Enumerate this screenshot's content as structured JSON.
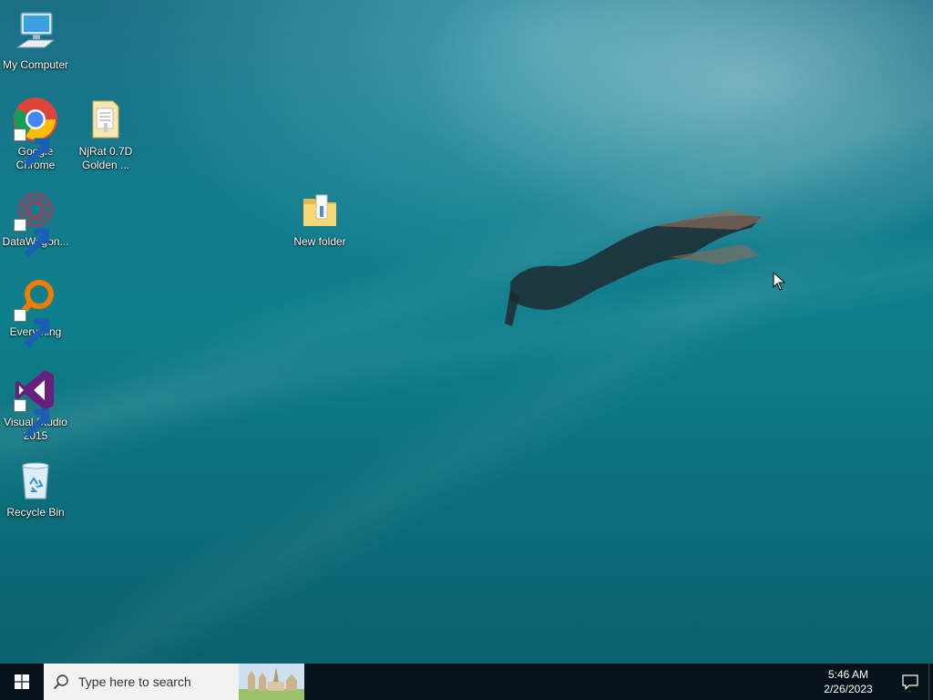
{
  "desktop": {
    "wallpaper": "underwater-diver",
    "icons": [
      {
        "label": "My Computer",
        "icon": "computer-icon"
      },
      {
        "label": "Google Chrome",
        "icon": "chrome-icon"
      },
      {
        "label": "NjRat 0.7D Golden ...",
        "icon": "document-folder-icon"
      },
      {
        "label": "DataWagon...",
        "icon": "datawagon-icon"
      },
      {
        "label": "New folder",
        "icon": "folder-icon"
      },
      {
        "label": "Everything",
        "icon": "everything-search-icon"
      },
      {
        "label": "Visual Studio 2015",
        "icon": "visual-studio-icon"
      },
      {
        "label": "Recycle Bin",
        "icon": "recycle-bin-icon"
      }
    ]
  },
  "taskbar": {
    "start_icon": "windows-logo-icon",
    "search_placeholder": "Type here to search",
    "time": "5:46 AM",
    "date": "2/26/2023",
    "notification_icon": "action-center-icon"
  },
  "colors": {
    "taskbar_bg": "#07131a",
    "search_bg": "#f2f2f2",
    "ocean_top": "#1d6f86",
    "ocean_bottom": "#0a5d6a"
  }
}
